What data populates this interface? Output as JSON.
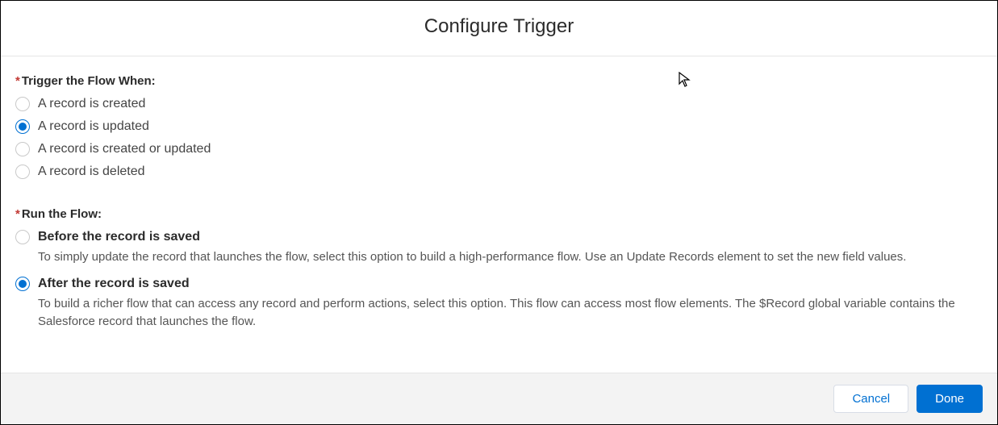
{
  "header": {
    "title": "Configure Trigger"
  },
  "required_marker": "*",
  "trigger_when": {
    "label": "Trigger the Flow When:",
    "options": [
      {
        "label": "A record is created",
        "selected": false
      },
      {
        "label": "A record is updated",
        "selected": true
      },
      {
        "label": "A record is created or updated",
        "selected": false
      },
      {
        "label": "A record is deleted",
        "selected": false
      }
    ]
  },
  "run_flow": {
    "label": "Run the Flow:",
    "options": [
      {
        "label": "Before the record is saved",
        "desc": "To simply update the record that launches the flow, select this option to build a high-performance flow. Use an Update Records element to set the new field values.",
        "selected": false
      },
      {
        "label": "After the record is saved",
        "desc": "To build a richer flow that can access any record and perform actions, select this option. This flow can access most flow elements. The $Record global variable contains the Salesforce record that launches the flow.",
        "selected": true
      }
    ]
  },
  "footer": {
    "cancel": "Cancel",
    "done": "Done"
  }
}
